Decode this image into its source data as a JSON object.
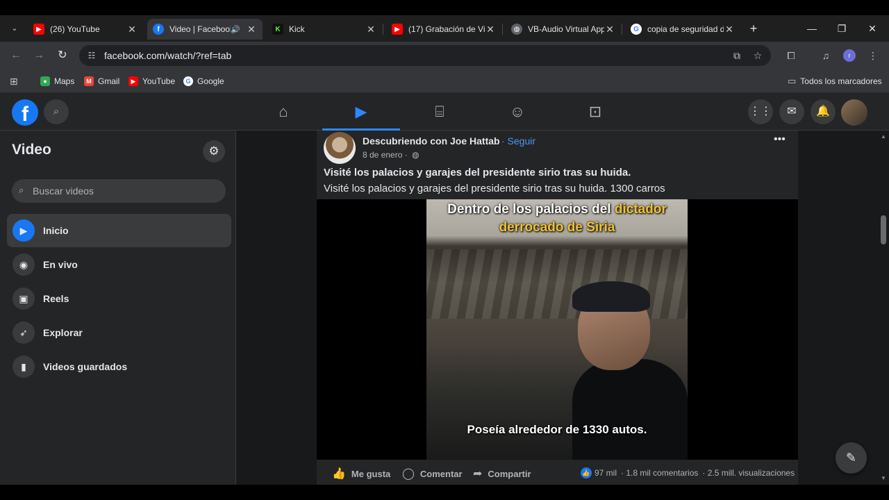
{
  "browser": {
    "tabs": [
      {
        "title": "(26) YouTube",
        "favicon": "youtube-icon",
        "color": "#ff0000"
      },
      {
        "title": "Video | Facebook",
        "favicon": "facebook-icon",
        "color": "#1877f2",
        "active": true
      },
      {
        "title": "Kick",
        "favicon": "kick-icon",
        "color": "#53fc18"
      },
      {
        "title": "(17) Grabación de Vi",
        "favicon": "youtube-icon",
        "color": "#ff0000"
      },
      {
        "title": "VB-Audio Virtual App",
        "favicon": "globe-icon",
        "color": "#5f6368"
      },
      {
        "title": "copia de seguridad d",
        "favicon": "google-icon",
        "color": "#4285f4"
      }
    ],
    "url": "facebook.com/watch/?ref=tab",
    "profile_initial": "r",
    "bookmarks": [
      {
        "label": "Maps",
        "icon": "maps-icon"
      },
      {
        "label": "Gmail",
        "icon": "gmail-icon"
      },
      {
        "label": "YouTube",
        "icon": "youtube-icon"
      },
      {
        "label": "Google",
        "icon": "google-icon"
      }
    ],
    "all_bookmarks": "Todos los marcadores"
  },
  "facebook": {
    "logo_letter": "f",
    "sidebar": {
      "title": "Video",
      "search_placeholder": "Buscar videos",
      "items": [
        {
          "label": "Inicio",
          "icon": "play-icon",
          "active": true
        },
        {
          "label": "En vivo",
          "icon": "live-icon"
        },
        {
          "label": "Reels",
          "icon": "reels-icon"
        },
        {
          "label": "Explorar",
          "icon": "rocket-icon"
        },
        {
          "label": "Videos guardados",
          "icon": "bookmark-icon"
        }
      ]
    },
    "post": {
      "author": "Descubriendo con Joe Hattab",
      "follow": "· Seguir",
      "date": "8 de enero ·",
      "title": "Visité los palacios y garajes del presidente sirio tras su huida.",
      "description": "Visité los palacios y garajes del presidente sirio tras su huida.  1300 carros",
      "video": {
        "caption_line1_white": "Dentro de los palacios del",
        "caption_line1_yellow": "dictador",
        "caption_line2": "derrocado de Siria",
        "subtitle": "Poseía alrededor de 1330 autos."
      },
      "actions": {
        "like": "Me gusta",
        "comment": "Comentar",
        "share": "Compartir"
      },
      "stats": {
        "reactions": "97 mil",
        "comments": "· 1.8 mil comentarios",
        "views": "· 2.5 mill. visualizaciones"
      }
    }
  }
}
